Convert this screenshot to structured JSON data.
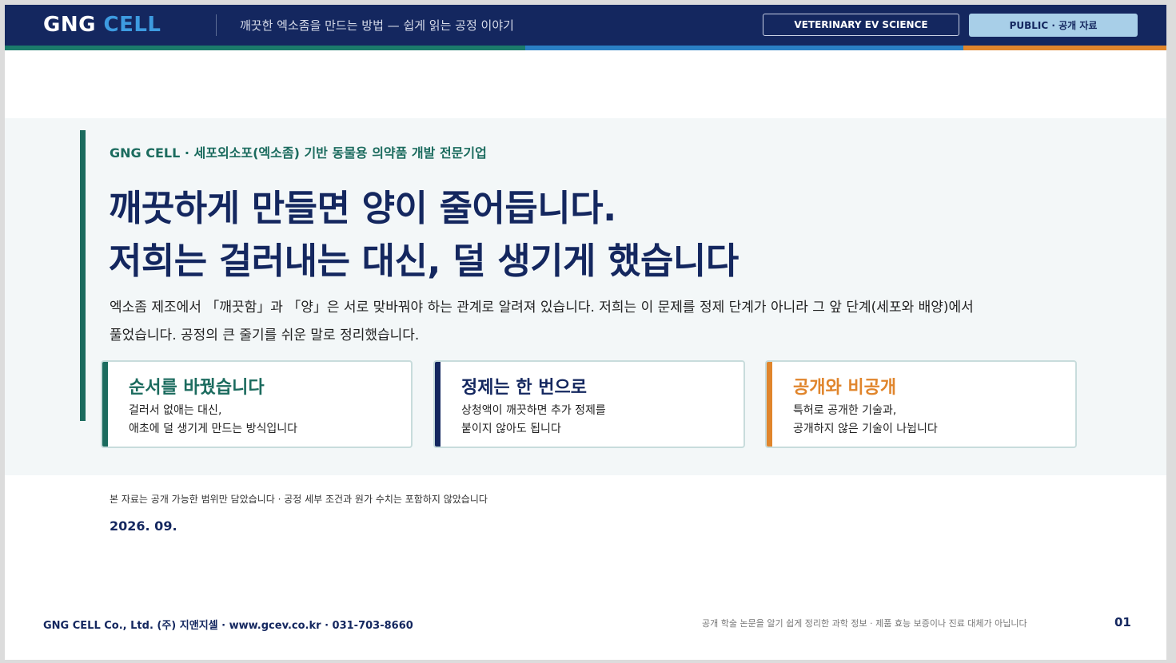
{
  "header": {
    "brand_gng": "GNG",
    "brand_cell": "CELL",
    "subtitle": "깨끗한 엑소좀을 만드는 방법 — 쉽게 읽는 공정 이야기",
    "badge_science": "VETERINARY EV SCIENCE",
    "badge_public": "PUBLIC · 공개 자료"
  },
  "colors": {
    "navy": "#14275f",
    "teal": "#1b6b5e",
    "blue": "#2a7fc4",
    "orange": "#e0852c",
    "light_blue": "#a8cfe8"
  },
  "hero": {
    "eyebrow": "GNG CELL  ·  세포외소포(엑소좀) 기반 동물용 의약품 개발 전문기업",
    "headline_line1": "깨끗하게 만들면 양이 줄어듭니다.",
    "headline_line2": "저희는 걸러내는 대신, 덜 생기게 했습니다",
    "lead_line1": "엑소좀 제조에서 「깨끗함」과 「양」은 서로 맞바꿔야 하는 관계로 알려져 있습니다. 저희는 이 문제를 정제 단계가 아니라 그 앞 단계(세포와 배양)에서",
    "lead_line2": "풀었습니다. 공정의 큰 줄기를 쉬운 말로 정리했습니다."
  },
  "cards": [
    {
      "title": "순서를 바꿨습니다",
      "line1": "걸러서 없애는 대신,",
      "line2": "애초에 덜 생기게 만드는 방식입니다"
    },
    {
      "title": "정제는 한 번으로",
      "line1": "상청액이 깨끗하면 추가 정제를",
      "line2": "붙이지 않아도 됩니다"
    },
    {
      "title": "공개와 비공개",
      "line1": "특허로 공개한 기술과,",
      "line2": "공개하지 않은 기술이 나뉩니다"
    }
  ],
  "note": "본 자료는 공개 가능한 범위만 담았습니다 · 공정 세부 조건과 원가 수치는 포함하지 않았습니다",
  "date": "2026. 09.",
  "footer": {
    "company": "GNG CELL Co., Ltd. (주) 지앤지셀 · www.gcev.co.kr · 031-703-8660",
    "disclaimer": "공개 학술 논문을 알기 쉽게 정리한 과학 정보 · 제품 효능 보증이나 진료 대체가 아닙니다",
    "page_number": "01"
  }
}
